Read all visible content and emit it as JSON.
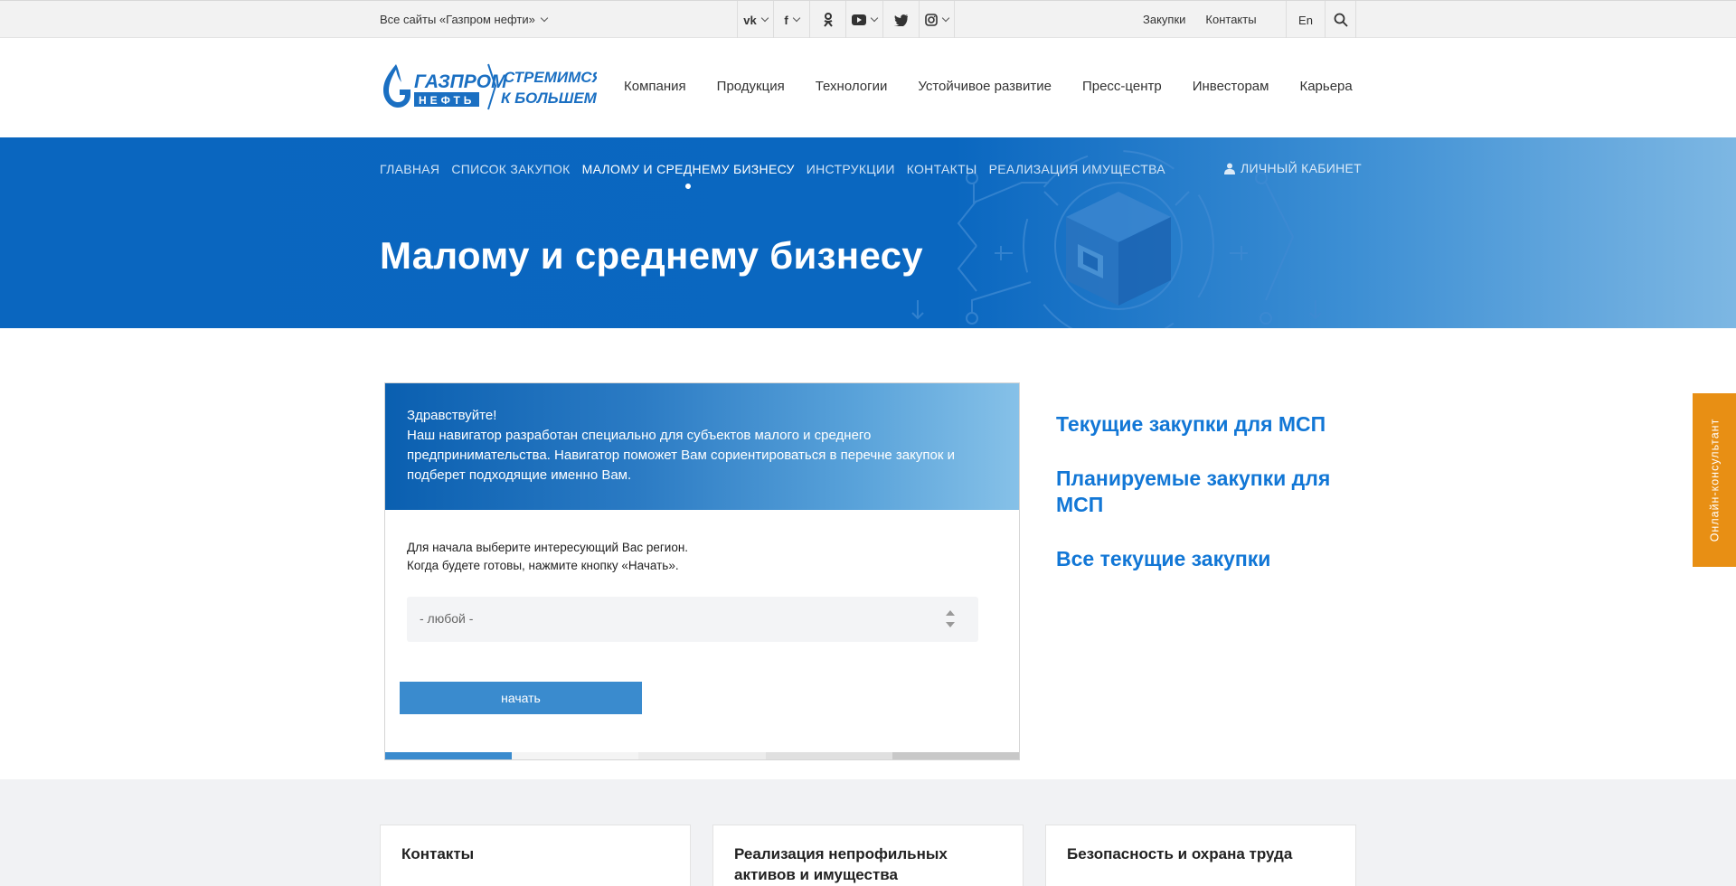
{
  "topbar": {
    "all_sites": "Все сайты «Газпром нефти»",
    "social_icons": [
      "vk-icon",
      "facebook-icon",
      "odnoklassniki-icon",
      "youtube-icon",
      "twitter-icon",
      "instagram-icon"
    ],
    "links": [
      "Закупки",
      "Контакты"
    ],
    "lang": "En"
  },
  "logo": {
    "brand_line1": "ГАЗПРОМ",
    "brand_line2": "НЕФТЬ",
    "slogan_line1": "СТРЕМИМСЯ",
    "slogan_line2": "К БОЛЬШЕМУ!"
  },
  "mainnav": [
    "Компания",
    "Продукция",
    "Технологии",
    "Устойчивое развитие",
    "Пресс-центр",
    "Инвесторам",
    "Карьера"
  ],
  "subnav": {
    "items": [
      "ГЛАВНАЯ",
      "СПИСОК ЗАКУПОК",
      "МАЛОМУ И СРЕДНЕМУ БИЗНЕСУ",
      "ИНСТРУКЦИИ",
      "КОНТАКТЫ",
      "РЕАЛИЗАЦИЯ ИМУЩЕСТВА"
    ],
    "active": "МАЛОМУ И СРЕДНЕМУ БИЗНЕСУ",
    "cabinet": "ЛИЧНЫЙ КАБИНЕТ"
  },
  "hero": {
    "title": "Малому и среднему бизнесу"
  },
  "navigator": {
    "greeting": "Здравствуйте!",
    "intro": "Наш навигатор разработан специально для субъектов малого и среднего предпринимательства. Навигатор поможет Вам сориентироваться в перечне закупок и подберет подходящие именно Вам.",
    "instruction_line1": "Для начала выберите интересующий Вас регион.",
    "instruction_line2": "Когда будете готовы, нажмите кнопку «Начать».",
    "region_value": "- любой -",
    "start_label": "начать",
    "step_colors": [
      "#3a8bce",
      "#f4f4f4",
      "#ececec",
      "#e0e0e0",
      "#c8c8c8"
    ]
  },
  "rightlinks": [
    "Текущие закупки для МСП",
    "Планируемые закупки для МСП",
    "Все текущие закупки"
  ],
  "consultant": "Онлайн-консультант",
  "tiles": [
    "Контакты",
    "Реализация непрофильных активов и имущества",
    "Безопасность и охрана труда"
  ],
  "colors": {
    "accent": "#1277d6",
    "hero_blue": "#0a66bf",
    "button": "#3a8bce",
    "consultant": "#e88f14"
  }
}
